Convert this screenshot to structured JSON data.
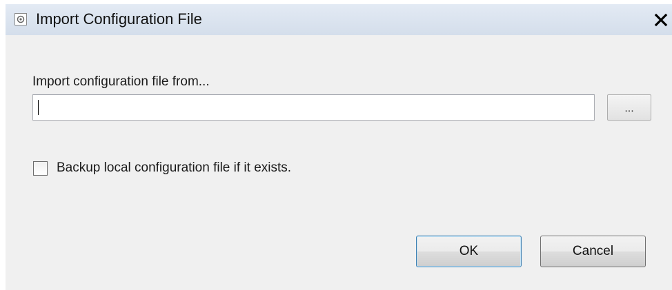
{
  "window": {
    "title": "Import Configuration File",
    "title_icon": "settings-app-icon",
    "close_glyph": "✕"
  },
  "form": {
    "path_label": "Import configuration file from...",
    "path_value": "",
    "browse_label": "...",
    "backup_checkbox_label": "Backup local configuration file if it exists.",
    "backup_checked": false
  },
  "buttons": {
    "ok_label": "OK",
    "cancel_label": "Cancel"
  }
}
